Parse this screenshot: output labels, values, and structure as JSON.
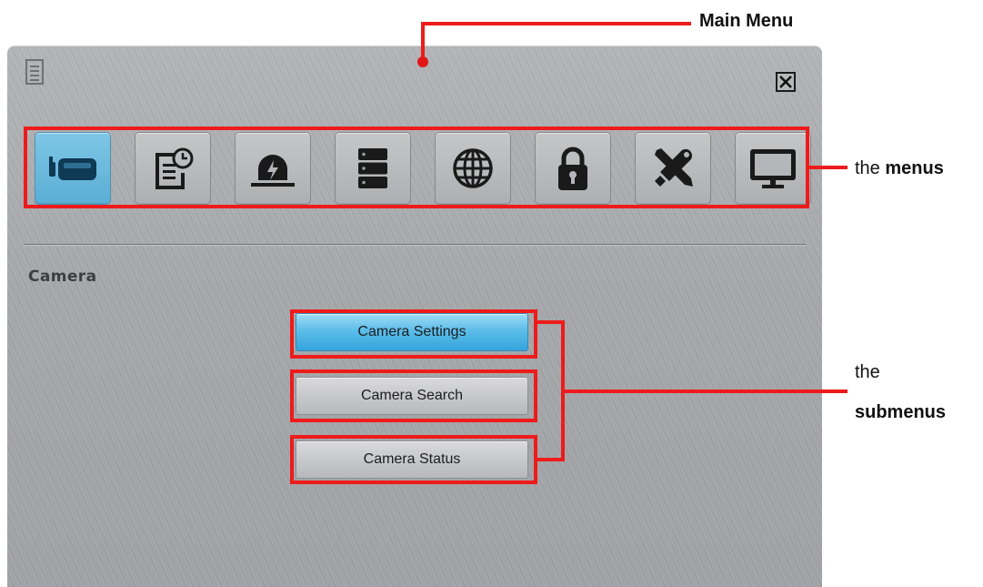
{
  "annotations": {
    "main_menu": "Main Menu",
    "menus_prefix": "the ",
    "menus_bold": "menus",
    "submenus_prefix": "the",
    "submenus_bold": "submenus",
    "color": "#ee1b1b"
  },
  "window": {
    "title_icon": "document-list-icon",
    "close_icon": "close-icon"
  },
  "menu_icons": [
    {
      "name": "camera-icon",
      "active": true
    },
    {
      "name": "record-schedule-icon",
      "active": false
    },
    {
      "name": "alarm-event-icon",
      "active": false
    },
    {
      "name": "storage-icon",
      "active": false
    },
    {
      "name": "network-globe-icon",
      "active": false
    },
    {
      "name": "security-lock-icon",
      "active": false
    },
    {
      "name": "tools-icon",
      "active": false
    },
    {
      "name": "display-monitor-icon",
      "active": false
    }
  ],
  "section": {
    "title": "Camera"
  },
  "submenu": {
    "items": [
      {
        "label": "Camera Settings",
        "active": true
      },
      {
        "label": "Camera Search",
        "active": false
      },
      {
        "label": "Camera Status",
        "active": false
      }
    ]
  },
  "colors": {
    "active_blue": "#34a4dc",
    "panel_gray": "#a9aaad"
  }
}
